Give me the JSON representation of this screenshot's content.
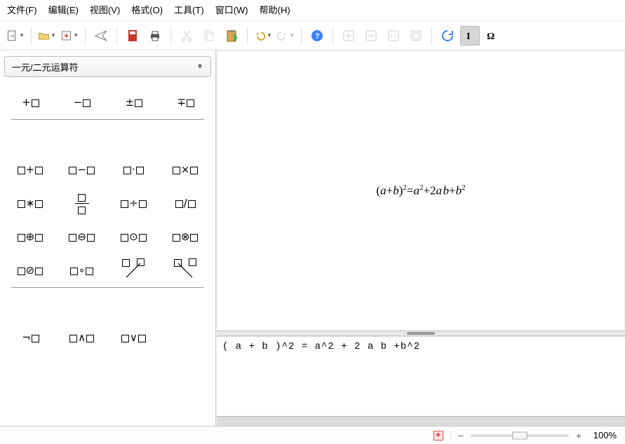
{
  "menu": {
    "file": "文件(F)",
    "edit": "编辑(E)",
    "view": "视图(V)",
    "format": "格式(O)",
    "tools": "工具(T)",
    "window": "窗口(W)",
    "help": "帮助(H)"
  },
  "sidebar": {
    "combo_selected": "一元/二元运算符"
  },
  "formula": {
    "source": "( a + b )^2 = a^2 + 2 a b +b^2"
  },
  "status": {
    "zoom_label": "100%"
  },
  "chart_data": {
    "type": "table",
    "title": "Unary/Binary operator palette",
    "rows": [
      [
        "+x",
        "−x",
        "±x",
        "∓x"
      ],
      [
        "x+y",
        "x−y",
        "x·y",
        "x×y"
      ],
      [
        "x*y",
        "x/y (stacked)",
        "x÷y",
        "x/y"
      ],
      [
        "x⊕y",
        "x⊖y",
        "x⊙y",
        "x⊗y"
      ],
      [
        "x⊘y",
        "x∘y",
        "x wideslash y",
        "x widebslash y"
      ],
      [
        "¬x",
        "x∧y",
        "x∨y",
        ""
      ]
    ]
  }
}
